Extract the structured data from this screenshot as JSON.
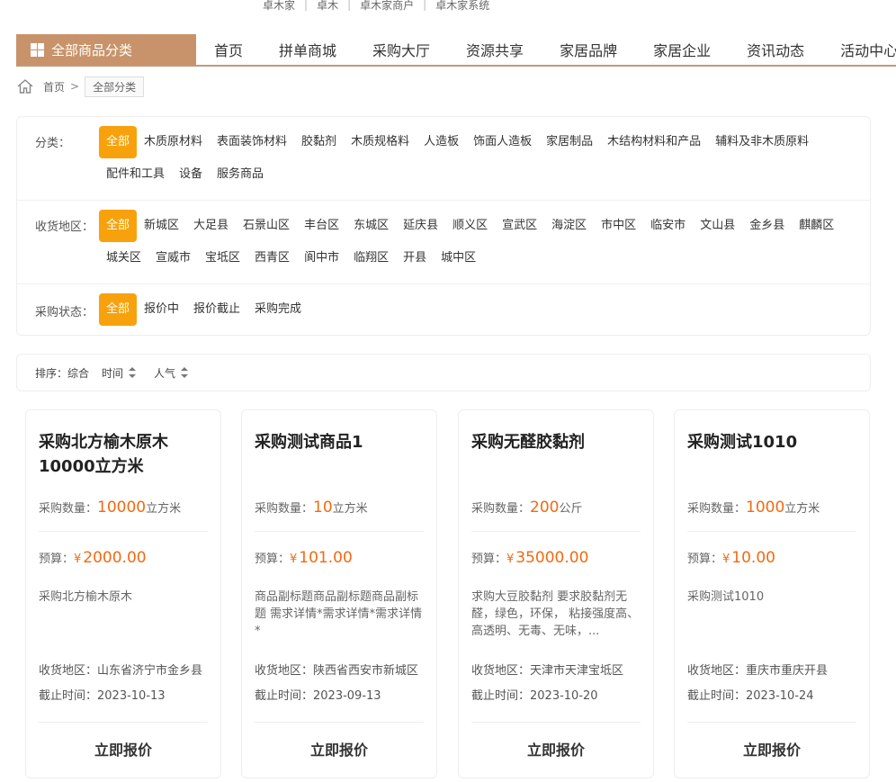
{
  "top_links": [
    "卓木家",
    "卓木",
    "卓木家商户",
    "卓木家系统"
  ],
  "nav": {
    "category_button": "全部商品分类",
    "items": [
      "首页",
      "拼单商城",
      "采购大厅",
      "资源共享",
      "家居品牌",
      "家居企业",
      "资讯动态",
      "活动中心"
    ]
  },
  "breadcrumb": {
    "home": "首页",
    "arrow": ">",
    "current": "全部分类"
  },
  "filters": {
    "category": {
      "label": "分类：",
      "options": [
        "全部",
        "木质原材料",
        "表面装饰材料",
        "胶黏剂",
        "木质规格料",
        "人造板",
        "饰面人造板",
        "家居制品",
        "木结构材料和产品",
        "辅料及非木质原料",
        "配件和工具",
        "设备",
        "服务商品"
      ]
    },
    "region": {
      "label": "收货地区：",
      "options": [
        "全部",
        "新城区",
        "大足县",
        "石景山区",
        "丰台区",
        "东城区",
        "延庆县",
        "顺义区",
        "宣武区",
        "海淀区",
        "市中区",
        "临安市",
        "文山县",
        "金乡县",
        "麒麟区",
        "城关区",
        "宣威市",
        "宝坻区",
        "西青区",
        "阆中市",
        "临翔区",
        "开县",
        "城中区"
      ]
    },
    "status": {
      "label": "采购状态：",
      "options": [
        "全部",
        "报价中",
        "报价截止",
        "采购完成"
      ]
    }
  },
  "sort": {
    "label": "排序：综合",
    "time": "时间",
    "popularity": "人气"
  },
  "labels": {
    "quantity": "采购数量：",
    "budget": "预算：",
    "currency": "¥",
    "address": "收货地区：",
    "deadline": "截止时间：",
    "quote_button": "立即报价"
  },
  "cards": [
    {
      "title": "采购北方榆木原木10000立方米",
      "quantity": "10000",
      "unit": "立方米",
      "budget": "2000.00",
      "description": "采购北方榆木原木",
      "address": "山东省济宁市金乡县",
      "deadline": "2023-10-13"
    },
    {
      "title": "采购测试商品1",
      "quantity": "10",
      "unit": "立方米",
      "budget": "101.00",
      "description": "商品副标题商品副标题商品副标题 需求详情*需求详情*需求详情*",
      "address": "陕西省西安市新城区",
      "deadline": "2023-09-13"
    },
    {
      "title": "采购无醛胶黏剂",
      "quantity": "200",
      "unit": "公斤",
      "budget": "35000.00",
      "description": "求购大豆胶黏剂 要求胶黏剂无醛，绿色，环保， 粘接强度高、高透明、无毒、无味，...",
      "address": "天津市天津宝坻区",
      "deadline": "2023-10-20"
    },
    {
      "title": "采购测试1010",
      "quantity": "1000",
      "unit": "立方米",
      "budget": "10.00",
      "description": "采购测试1010",
      "address": "重庆市重庆开县",
      "deadline": "2023-10-24"
    }
  ],
  "colors": {
    "accent": "#f7a20d",
    "brand": "#c8936b",
    "price": "#f26a10"
  }
}
